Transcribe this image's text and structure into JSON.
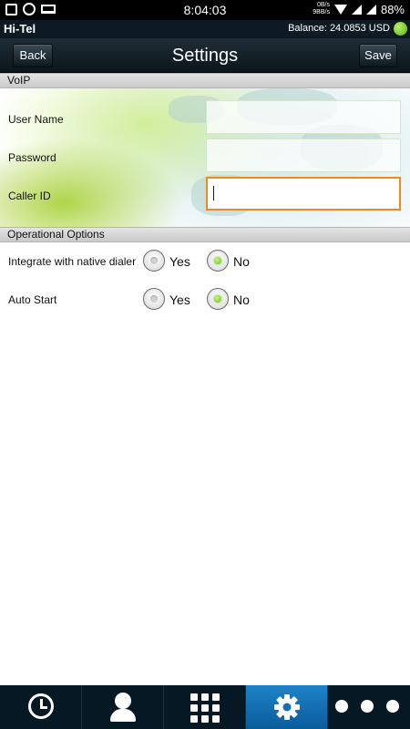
{
  "statusbar": {
    "time": "8:04:03",
    "net_up": "0B/s",
    "net_down": "9BB/s",
    "battery": "88%"
  },
  "appbar": {
    "app_name": "Hi-Tel",
    "balance": "Balance: 24.0853 USD",
    "status_color": "#6cc11e"
  },
  "header": {
    "back_label": "Back",
    "title": "Settings",
    "save_label": "Save"
  },
  "voip": {
    "section_title": "VoIP",
    "username_label": "User Name",
    "username_value": "",
    "password_label": "Password",
    "password_value": "",
    "callerid_label": "Caller ID",
    "callerid_value": ""
  },
  "options": {
    "section_title": "Operational Options",
    "integrate_label": "Integrate with native dialer",
    "integrate_selected": "No",
    "autostart_label": "Auto Start",
    "autostart_selected": "No",
    "yes_label": "Yes",
    "no_label": "No"
  },
  "nav": {
    "items": [
      "history-icon",
      "contacts-icon",
      "dialpad-icon",
      "settings-icon",
      "more-icon"
    ],
    "active": "settings-icon",
    "active_color": "#1f82c9"
  }
}
